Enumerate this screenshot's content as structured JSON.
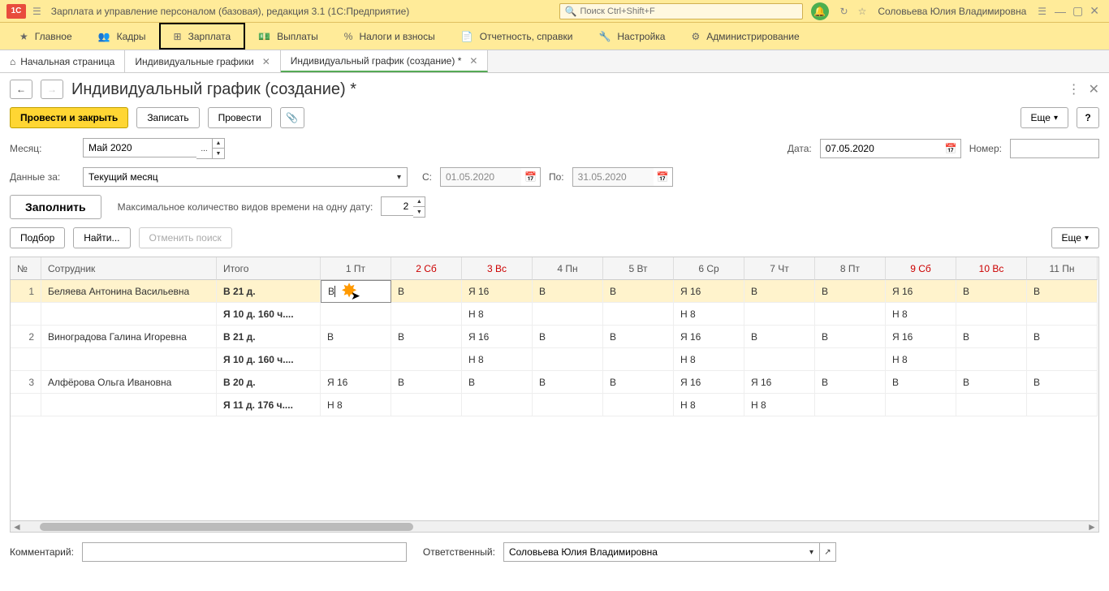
{
  "titlebar": {
    "app_title": "Зарплата и управление персоналом (базовая), редакция 3.1  (1С:Предприятие)",
    "search_placeholder": "Поиск Ctrl+Shift+F",
    "user": "Соловьева Юлия Владимировна"
  },
  "mainnav": {
    "items": [
      {
        "label": "Главное",
        "icon": "star"
      },
      {
        "label": "Кадры",
        "icon": "people"
      },
      {
        "label": "Зарплата",
        "icon": "calc",
        "active": true
      },
      {
        "label": "Выплаты",
        "icon": "money"
      },
      {
        "label": "Налоги и взносы",
        "icon": "percent"
      },
      {
        "label": "Отчетность, справки",
        "icon": "doc"
      },
      {
        "label": "Настройка",
        "icon": "wrench"
      },
      {
        "label": "Администрирование",
        "icon": "gear"
      }
    ]
  },
  "tabs": {
    "items": [
      {
        "label": "Начальная страница",
        "home": true
      },
      {
        "label": "Индивидуальные графики",
        "close": true
      },
      {
        "label": "Индивидуальный график (создание) *",
        "close": true,
        "active": true
      }
    ]
  },
  "page": {
    "title": "Индивидуальный график (создание) *",
    "post_close": "Провести и закрыть",
    "save": "Записать",
    "post": "Провести",
    "more": "Еще",
    "help": "?"
  },
  "fields": {
    "month_label": "Месяц:",
    "month_value": "Май 2020",
    "date_label": "Дата:",
    "date_value": "07.05.2020",
    "number_label": "Номер:",
    "number_value": "",
    "data_for_label": "Данные за:",
    "data_for_value": "Текущий месяц",
    "from_label": "С:",
    "from_value": "01.05.2020",
    "to_label": "По:",
    "to_value": "31.05.2020",
    "fill": "Заполнить",
    "max_types_label": "Максимальное количество видов времени на одну дату:",
    "max_types_value": "2",
    "select": "Подбор",
    "find": "Найти...",
    "cancel_search": "Отменить поиск",
    "more2": "Еще"
  },
  "table": {
    "headers": {
      "num": "№",
      "emp": "Сотрудник",
      "total": "Итого",
      "d1": "1 Пт",
      "d2": "2 Сб",
      "d3": "3 Вс",
      "d4": "4 Пн",
      "d5": "5 Вт",
      "d6": "6 Ср",
      "d7": "7 Чт",
      "d8": "8 Пт",
      "d9": "9 Сб",
      "d10": "10 Вс",
      "d11": "11 Пн"
    },
    "rows": [
      {
        "n": "1",
        "emp": "Беляева Антонина Васильевна",
        "t1": "В 21 д.",
        "t2": "Я 10 д. 160 ч....",
        "r1": [
          "В",
          "В",
          "Я 16",
          "В",
          "В",
          "Я 16",
          "В",
          "В",
          "Я 16",
          "В",
          "В"
        ],
        "r2": [
          "",
          "",
          "Н 8",
          "",
          "",
          "Н 8",
          "",
          "",
          "Н 8",
          "",
          ""
        ],
        "sel": true
      },
      {
        "n": "2",
        "emp": "Виноградова Галина Игоревна",
        "t1": "В 21 д.",
        "t2": "Я 10 д. 160 ч....",
        "r1": [
          "В",
          "В",
          "Я 16",
          "В",
          "В",
          "Я 16",
          "В",
          "В",
          "Я 16",
          "В",
          "В"
        ],
        "r2": [
          "",
          "",
          "Н 8",
          "",
          "",
          "Н 8",
          "",
          "",
          "Н 8",
          "",
          ""
        ]
      },
      {
        "n": "3",
        "emp": "Алфёрова Ольга Ивановна",
        "t1": "В 20 д.",
        "t2": "Я 11 д. 176 ч....",
        "r1": [
          "Я 16",
          "В",
          "В",
          "В",
          "В",
          "Я 16",
          "Я 16",
          "В",
          "В",
          "В",
          "В"
        ],
        "r2": [
          "Н 8",
          "",
          "",
          "",
          "",
          "Н 8",
          "Н 8",
          "",
          "",
          "",
          ""
        ]
      }
    ]
  },
  "footer": {
    "comment_label": "Комментарий:",
    "comment_value": "",
    "resp_label": "Ответственный:",
    "resp_value": "Соловьева Юлия Владимировна"
  }
}
